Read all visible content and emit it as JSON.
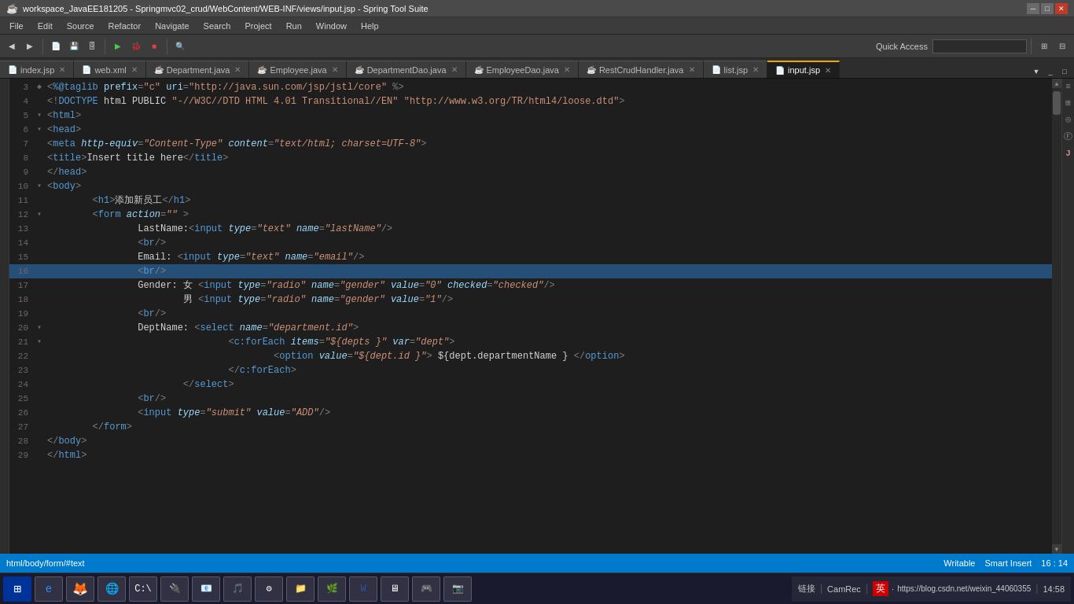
{
  "titleBar": {
    "icon": "☕",
    "title": "workspace_JavaEE181205 - Springmvc02_crud/WebContent/WEB-INF/views/input.jsp - Spring Tool Suite",
    "minimize": "─",
    "maximize": "□",
    "close": "✕"
  },
  "menuBar": {
    "items": [
      "File",
      "Edit",
      "Source",
      "Refactor",
      "Navigate",
      "Search",
      "Project",
      "Run",
      "Window",
      "Help"
    ]
  },
  "toolbar": {
    "quickAccess": "Quick Access"
  },
  "tabs": [
    {
      "id": "index.jsp",
      "label": "index.jsp",
      "active": false,
      "icon": "📄"
    },
    {
      "id": "web.xml",
      "label": "web.xml",
      "active": false,
      "icon": "📄"
    },
    {
      "id": "Department.java",
      "label": "Department.java",
      "active": false,
      "icon": "☕"
    },
    {
      "id": "Employee.java",
      "label": "Employee.java",
      "active": false,
      "icon": "☕"
    },
    {
      "id": "DepartmentDao.java",
      "label": "DepartmentDao.java",
      "active": false,
      "icon": "☕"
    },
    {
      "id": "EmployeeDao.java",
      "label": "EmployeeDao.java",
      "active": false,
      "icon": "☕"
    },
    {
      "id": "RestCrudHandler.java",
      "label": "RestCrudHandler.java",
      "active": false,
      "icon": "☕"
    },
    {
      "id": "list.jsp",
      "label": "list.jsp",
      "active": false,
      "icon": "📄"
    },
    {
      "id": "input.jsp",
      "label": "input.jsp",
      "active": true,
      "icon": "📄"
    }
  ],
  "codeLines": [
    {
      "num": "3",
      "fold": "◆",
      "content": "<%@taglib prefix=\"c\" uri=\"http://java.sun.com/jsp/jstl/core\" %>",
      "selected": false
    },
    {
      "num": "4",
      "fold": " ",
      "content": "<!DOCTYPE html PUBLIC \"-//W3C//DTD HTML 4.01 Transitional//EN\" \"http://www.w3.org/TR/html4/loose.dtd\">",
      "selected": false
    },
    {
      "num": "5",
      "fold": "▾",
      "content": "<html>",
      "selected": false
    },
    {
      "num": "6",
      "fold": "▾",
      "content": "<head>",
      "selected": false
    },
    {
      "num": "7",
      "fold": " ",
      "content": "  <meta http-equiv=\"Content-Type\" content=\"text/html; charset=UTF-8\">",
      "selected": false
    },
    {
      "num": "8",
      "fold": " ",
      "content": "  <title>Insert title here</title>",
      "selected": false
    },
    {
      "num": "9",
      "fold": " ",
      "content": "</head>",
      "selected": false
    },
    {
      "num": "10",
      "fold": "▾",
      "content": "<body>",
      "selected": false
    },
    {
      "num": "11",
      "fold": " ",
      "content": "        <h1>添加新员工</h1>",
      "selected": false
    },
    {
      "num": "12",
      "fold": "▾",
      "content": "        <form action=\"\" >",
      "selected": false
    },
    {
      "num": "13",
      "fold": " ",
      "content": "                LastName:<input type=\"text\" name=\"lastName\"/>",
      "selected": false
    },
    {
      "num": "14",
      "fold": " ",
      "content": "                <br/>",
      "selected": false
    },
    {
      "num": "15",
      "fold": " ",
      "content": "                Email: <input type=\"text\" name=\"email\"/>",
      "selected": false
    },
    {
      "num": "16",
      "fold": " ",
      "content": "                <br/>",
      "selected": true
    },
    {
      "num": "17",
      "fold": " ",
      "content": "                Gender: 女 <input type=\"radio\" name=\"gender\" value=\"0\" checked=\"checked\"/>",
      "selected": false
    },
    {
      "num": "18",
      "fold": " ",
      "content": "                        男 <input type=\"radio\" name=\"gender\" value=\"1\"/>",
      "selected": false
    },
    {
      "num": "19",
      "fold": " ",
      "content": "                <br/>",
      "selected": false
    },
    {
      "num": "20",
      "fold": "▾",
      "content": "                DeptName: <select name=\"department.id\">",
      "selected": false
    },
    {
      "num": "21",
      "fold": "▾",
      "content": "                                <c:forEach items=\"${depts }\" var=\"dept\">",
      "selected": false
    },
    {
      "num": "22",
      "fold": " ",
      "content": "                                        <option value=\"${dept.id }\"> ${dept.departmentName } </option>",
      "selected": false
    },
    {
      "num": "23",
      "fold": " ",
      "content": "                                </c:forEach>",
      "selected": false
    },
    {
      "num": "24",
      "fold": " ",
      "content": "                        </select>",
      "selected": false
    },
    {
      "num": "25",
      "fold": " ",
      "content": "                <br/>",
      "selected": false
    },
    {
      "num": "26",
      "fold": " ",
      "content": "                <input type=\"submit\" value=\"ADD\"/>",
      "selected": false
    },
    {
      "num": "27",
      "fold": " ",
      "content": "        </form>",
      "selected": false
    },
    {
      "num": "28",
      "fold": " ",
      "content": "</body>",
      "selected": false
    },
    {
      "num": "29",
      "fold": " ",
      "content": "</html>",
      "selected": false
    }
  ],
  "statusBar": {
    "breadcrumb": "html/body/form/#text",
    "writable": "Writable",
    "insertMode": "Smart Insert",
    "position": "16 : 14"
  },
  "taskbar": {
    "trayText": "链接",
    "camrecText": "CamRec",
    "imeText": "英",
    "url": "https://blog.csdn.net/weixin_44060355",
    "time": "14:58"
  }
}
